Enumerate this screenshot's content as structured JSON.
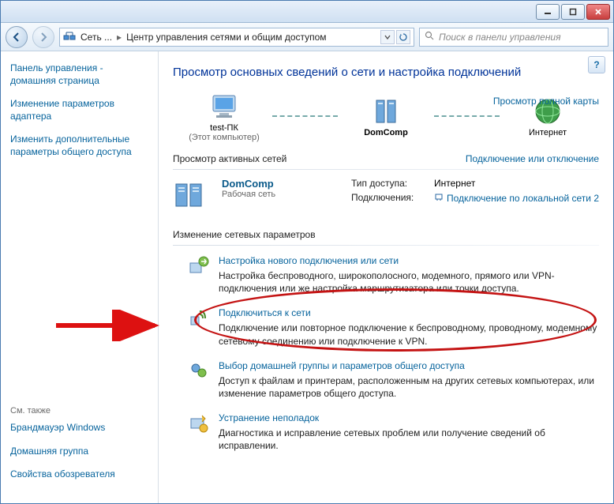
{
  "titlebar": {
    "min": "–",
    "max": "▢",
    "close": "×"
  },
  "nav": {
    "crumb1": "Сеть ...",
    "crumb2": "Центр управления сетями и общим доступом",
    "search_placeholder": "Поиск в панели управления"
  },
  "sidebar": {
    "home": "Панель управления - домашняя страница",
    "adapter": "Изменение параметров адаптера",
    "sharing": "Изменить дополнительные параметры общего доступа",
    "see_also_hdr": "См. также",
    "firewall": "Брандмауэр Windows",
    "homegroup": "Домашняя группа",
    "ie": "Свойства обозревателя"
  },
  "main": {
    "heading": "Просмотр основных сведений о сети и настройка подключений",
    "view_full_map": "Просмотр полной карты",
    "node_pc": "test-ПК",
    "node_pc_sub": "(Этот компьютер)",
    "node_net": "DomComp",
    "node_internet": "Интернет",
    "active_hdr": "Просмотр активных сетей",
    "connect_disconnect": "Подключение или отключение",
    "active_name": "DomComp",
    "active_kind": "Рабочая сеть",
    "access_lbl": "Тип доступа:",
    "access_val": "Интернет",
    "conn_lbl": "Подключения:",
    "conn_val": "Подключение по локальной сети 2",
    "change_hdr": "Изменение сетевых параметров",
    "tasks": [
      {
        "title": "Настройка нового подключения или сети",
        "desc": "Настройка беспроводного, широкополосного, модемного, прямого или VPN-подключения или же настройка маршрутизатора или точки доступа."
      },
      {
        "title": "Подключиться к сети",
        "desc": "Подключение или повторное подключение к беспроводному, проводному, модемному сетевому соединению или подключение к VPN."
      },
      {
        "title": "Выбор домашней группы и параметров общего доступа",
        "desc": "Доступ к файлам и принтерам, расположенным на других сетевых компьютерах, или изменение параметров общего доступа."
      },
      {
        "title": "Устранение неполадок",
        "desc": "Диагностика и исправление сетевых проблем или получение сведений об исправлении."
      }
    ]
  }
}
